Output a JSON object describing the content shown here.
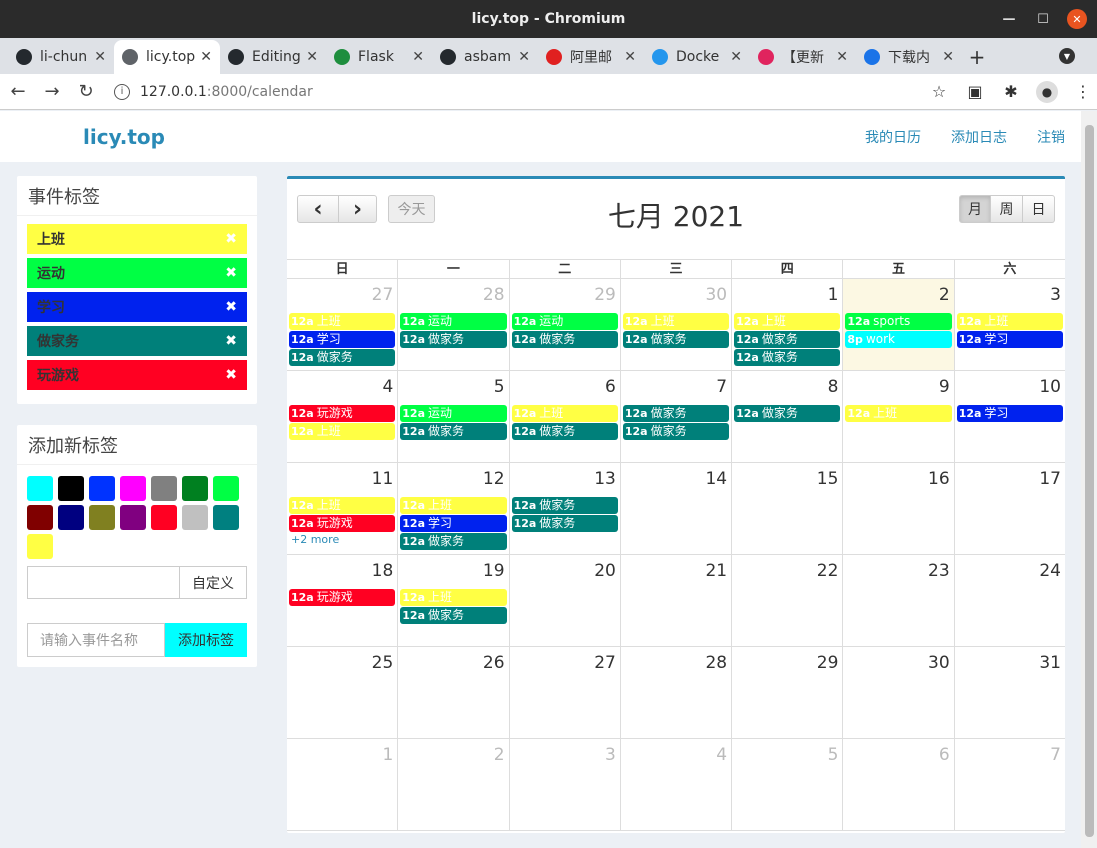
{
  "window": {
    "title": "licy.top - Chromium"
  },
  "tabs": [
    {
      "label": "li-chun",
      "fav_color": "#24292e",
      "fav_icon": "github-icon"
    },
    {
      "label": "licy.top",
      "fav_color": "#5f6368",
      "fav_icon": "globe-icon"
    },
    {
      "label": "Editing",
      "fav_color": "#24292e",
      "fav_icon": "github-icon"
    },
    {
      "label": "Flask",
      "fav_color": "#1e8e3e",
      "fav_icon": "c-icon"
    },
    {
      "label": "asbam",
      "fav_color": "#24292e",
      "fav_icon": "github-icon"
    },
    {
      "label": "阿里邮",
      "fav_color": "#e02020",
      "fav_icon": "mail-icon"
    },
    {
      "label": "Docke",
      "fav_color": "#2496ed",
      "fav_icon": "docker-icon"
    },
    {
      "label": "【更新",
      "fav_color": "#e0245e",
      "fav_icon": "y-icon"
    },
    {
      "label": "下载内",
      "fav_color": "#1a73e8",
      "fav_icon": "download-icon"
    }
  ],
  "address": {
    "host": "127.0.0.1",
    "path": ":8000/calendar"
  },
  "navbar": {
    "brand": "licy.top",
    "links": [
      "我的日历",
      "添加日志",
      "注销"
    ]
  },
  "tags_box": {
    "title": "事件标签",
    "tags": [
      {
        "label": "上班",
        "color": "#ffff44"
      },
      {
        "label": "运动",
        "color": "#00ff44"
      },
      {
        "label": "学习",
        "color": "#0022ee"
      },
      {
        "label": "做家务",
        "color": "#00807a"
      },
      {
        "label": "玩游戏",
        "color": "#ff0022"
      }
    ],
    "remove": "✖"
  },
  "new_tag_box": {
    "title": "添加新标签",
    "swatches": [
      "#00ffff",
      "#000000",
      "#0033ff",
      "#ff00ff",
      "#808080",
      "#008020",
      "#00ff44",
      "#800000",
      "#000080",
      "#808020",
      "#800080",
      "#ff0022",
      "#c0c0c0",
      "#008080",
      "#ffff44"
    ],
    "custom_label": "自定义",
    "name_placeholder": "请输入事件名称",
    "add_label": "添加标签"
  },
  "calendar": {
    "title": "七月 2021",
    "prev": "‹",
    "next": "›",
    "today": "今天",
    "views": [
      "月",
      "周",
      "日"
    ],
    "active_view": "月",
    "dow": [
      "日",
      "一",
      "二",
      "三",
      "四",
      "五",
      "六"
    ],
    "more_text": "+2 more",
    "weeks": [
      [
        {
          "n": "27",
          "other": true,
          "events": [
            {
              "t": "12a",
              "l": "上班",
              "c": "#ffff44"
            },
            {
              "t": "12a",
              "l": "学习",
              "c": "#0022ee"
            },
            {
              "t": "12a",
              "l": "做家务",
              "c": "#00807a"
            }
          ]
        },
        {
          "n": "28",
          "other": true,
          "events": [
            {
              "t": "12a",
              "l": "运动",
              "c": "#00ff44"
            },
            {
              "t": "12a",
              "l": "做家务",
              "c": "#00807a"
            }
          ]
        },
        {
          "n": "29",
          "other": true,
          "events": [
            {
              "t": "12a",
              "l": "运动",
              "c": "#00ff44"
            },
            {
              "t": "12a",
              "l": "做家务",
              "c": "#00807a"
            }
          ]
        },
        {
          "n": "30",
          "other": true,
          "events": [
            {
              "t": "12a",
              "l": "上班",
              "c": "#ffff44"
            },
            {
              "t": "12a",
              "l": "做家务",
              "c": "#00807a"
            }
          ]
        },
        {
          "n": "1",
          "events": [
            {
              "t": "12a",
              "l": "上班",
              "c": "#ffff44"
            },
            {
              "t": "12a",
              "l": "做家务",
              "c": "#00807a"
            },
            {
              "t": "12a",
              "l": "做家务",
              "c": "#00807a"
            }
          ]
        },
        {
          "n": "2",
          "today": true,
          "events": [
            {
              "t": "12a",
              "l": "sports",
              "c": "#00ff44"
            },
            {
              "t": "8p",
              "l": "work",
              "c": "#00ffff"
            }
          ]
        },
        {
          "n": "3",
          "events": [
            {
              "t": "12a",
              "l": "上班",
              "c": "#ffff44"
            },
            {
              "t": "12a",
              "l": "学习",
              "c": "#0022ee"
            }
          ]
        }
      ],
      [
        {
          "n": "4",
          "events": [
            {
              "t": "12a",
              "l": "玩游戏",
              "c": "#ff0022"
            },
            {
              "t": "12a",
              "l": "上班",
              "c": "#ffff44"
            }
          ]
        },
        {
          "n": "5",
          "events": [
            {
              "t": "12a",
              "l": "运动",
              "c": "#00ff44"
            },
            {
              "t": "12a",
              "l": "做家务",
              "c": "#00807a"
            }
          ]
        },
        {
          "n": "6",
          "events": [
            {
              "t": "12a",
              "l": "上班",
              "c": "#ffff44"
            },
            {
              "t": "12a",
              "l": "做家务",
              "c": "#00807a"
            }
          ]
        },
        {
          "n": "7",
          "events": [
            {
              "t": "12a",
              "l": "做家务",
              "c": "#00807a"
            },
            {
              "t": "12a",
              "l": "做家务",
              "c": "#00807a"
            }
          ]
        },
        {
          "n": "8",
          "events": [
            {
              "t": "12a",
              "l": "做家务",
              "c": "#00807a"
            }
          ]
        },
        {
          "n": "9",
          "events": [
            {
              "t": "12a",
              "l": "上班",
              "c": "#ffff44"
            }
          ]
        },
        {
          "n": "10",
          "events": [
            {
              "t": "12a",
              "l": "学习",
              "c": "#0022ee"
            }
          ]
        }
      ],
      [
        {
          "n": "11",
          "more": true,
          "events": [
            {
              "t": "12a",
              "l": "上班",
              "c": "#ffff44"
            },
            {
              "t": "12a",
              "l": "玩游戏",
              "c": "#ff0022"
            }
          ]
        },
        {
          "n": "12",
          "events": [
            {
              "t": "12a",
              "l": "上班",
              "c": "#ffff44"
            },
            {
              "t": "12a",
              "l": "学习",
              "c": "#0022ee"
            },
            {
              "t": "12a",
              "l": "做家务",
              "c": "#00807a"
            }
          ]
        },
        {
          "n": "13",
          "events": [
            {
              "t": "12a",
              "l": "做家务",
              "c": "#00807a"
            },
            {
              "t": "12a",
              "l": "做家务",
              "c": "#00807a"
            }
          ]
        },
        {
          "n": "14",
          "events": []
        },
        {
          "n": "15",
          "events": []
        },
        {
          "n": "16",
          "events": []
        },
        {
          "n": "17",
          "events": []
        }
      ],
      [
        {
          "n": "18",
          "events": [
            {
              "t": "12a",
              "l": "玩游戏",
              "c": "#ff0022"
            }
          ]
        },
        {
          "n": "19",
          "events": [
            {
              "t": "12a",
              "l": "上班",
              "c": "#ffff44"
            },
            {
              "t": "12a",
              "l": "做家务",
              "c": "#00807a"
            }
          ]
        },
        {
          "n": "20",
          "events": []
        },
        {
          "n": "21",
          "events": []
        },
        {
          "n": "22",
          "events": []
        },
        {
          "n": "23",
          "events": []
        },
        {
          "n": "24",
          "events": []
        }
      ],
      [
        {
          "n": "25",
          "events": []
        },
        {
          "n": "26",
          "events": []
        },
        {
          "n": "27",
          "events": []
        },
        {
          "n": "28",
          "events": []
        },
        {
          "n": "29",
          "events": []
        },
        {
          "n": "30",
          "events": []
        },
        {
          "n": "31",
          "events": []
        }
      ],
      [
        {
          "n": "1",
          "other": true,
          "events": []
        },
        {
          "n": "2",
          "other": true,
          "events": []
        },
        {
          "n": "3",
          "other": true,
          "events": []
        },
        {
          "n": "4",
          "other": true,
          "events": []
        },
        {
          "n": "5",
          "other": true,
          "events": []
        },
        {
          "n": "6",
          "other": true,
          "events": []
        },
        {
          "n": "7",
          "other": true,
          "events": []
        }
      ]
    ]
  }
}
